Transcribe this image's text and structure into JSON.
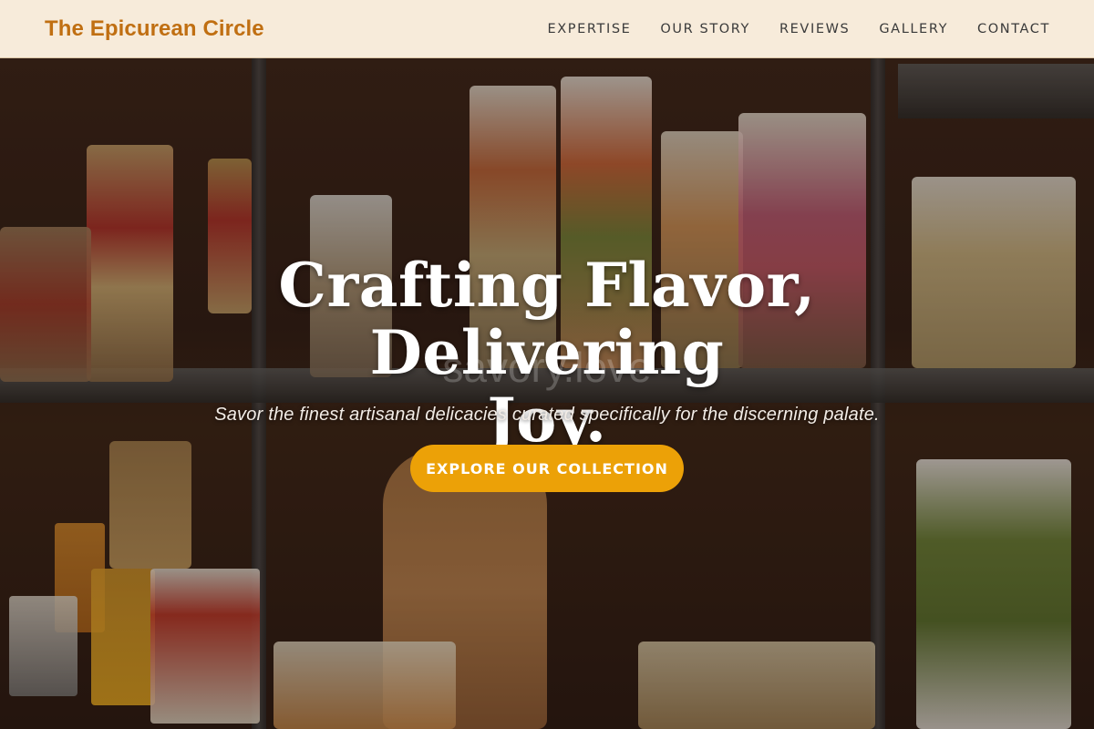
{
  "header": {
    "brand": "The Epicurean Circle",
    "nav": [
      "EXPERTISE",
      "OUR STORY",
      "REVIEWS",
      "GALLERY",
      "CONTACT"
    ]
  },
  "hero": {
    "headline_line1": "Crafting Flavor, Delivering",
    "headline_line2": "Joy.",
    "watermark": "savory.love",
    "subtitle": "Savor the finest artisanal delicacies curated specifically for the discerning palate.",
    "cta_label": "EXPLORE OUR COLLECTION"
  },
  "colors": {
    "header_bg": "#f7ebda",
    "brand": "#c06f12",
    "cta": "#eca107"
  },
  "icons": [
    "pantry-background-image"
  ]
}
